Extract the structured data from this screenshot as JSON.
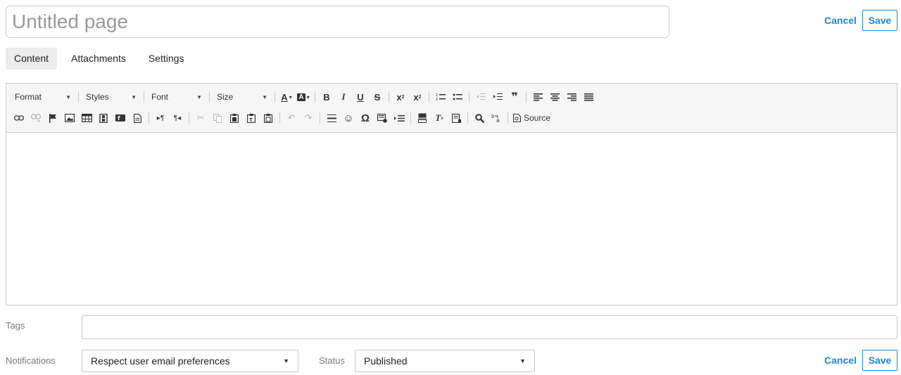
{
  "page": {
    "title_placeholder": "Untitled page",
    "cancel_label": "Cancel",
    "save_label": "Save"
  },
  "tabs": [
    {
      "label": "Content",
      "active": true
    },
    {
      "label": "Attachments",
      "active": false
    },
    {
      "label": "Settings",
      "active": false
    }
  ],
  "toolbar": {
    "format_label": "Format",
    "styles_label": "Styles",
    "font_label": "Font",
    "size_label": "Size",
    "source_label": "Source",
    "icons": [
      "text-color",
      "background-color",
      "bold",
      "italic",
      "underline",
      "strikethrough",
      "superscript",
      "subscript",
      "numbered-list",
      "bulleted-list",
      "decrease-indent",
      "increase-indent",
      "blockquote",
      "align-left",
      "align-center",
      "align-right",
      "justify",
      "link",
      "unlink",
      "anchor",
      "image",
      "table",
      "media",
      "flash",
      "template",
      "ltr",
      "rtl",
      "cut",
      "copy",
      "paste",
      "paste-text",
      "paste-word",
      "undo",
      "redo",
      "horizontal-rule",
      "smiley",
      "special-char",
      "iframe",
      "show-blocks",
      "page-break",
      "remove-format",
      "preview",
      "find",
      "replace",
      "source"
    ]
  },
  "form": {
    "tags_label": "Tags",
    "notifications_label": "Notifications",
    "notifications_value": "Respect user email preferences",
    "status_label": "Status",
    "status_value": "Published",
    "cancel_label": "Cancel",
    "save_label": "Save"
  },
  "colors": {
    "accent": "#1a8bd2",
    "border": "#c8c8c8",
    "toolbar_bg": "#f6f6f6",
    "tab_active_bg": "#ececec"
  }
}
